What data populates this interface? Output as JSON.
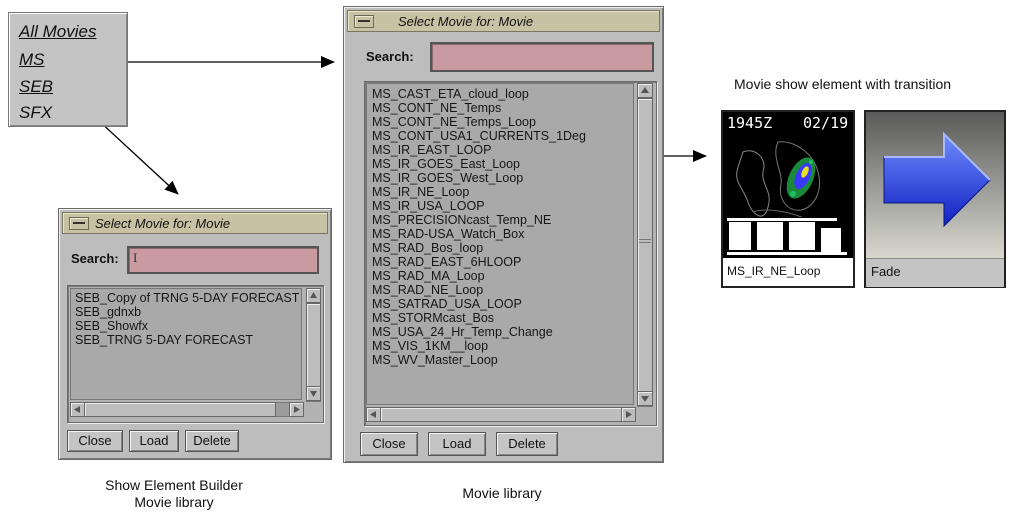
{
  "menu": {
    "items": [
      "All Movies",
      "MS",
      "SEB",
      "SFX"
    ]
  },
  "small_window": {
    "title": "Select Movie for: Movie",
    "search_label": "Search:",
    "search_value": "I",
    "list": [
      "SEB_Copy of TRNG 5-DAY FORECAST",
      "SEB_gdnxb",
      "SEB_Showfx",
      "SEB_TRNG 5-DAY FORECAST"
    ],
    "buttons": {
      "close": "Close",
      "load": "Load",
      "delete": "Delete"
    }
  },
  "large_window": {
    "title": "Select Movie for: Movie",
    "search_label": "Search:",
    "search_value": "",
    "list": [
      "MS_CAST_ETA_cloud_loop",
      "MS_CONT_NE_Temps",
      "MS_CONT_NE_Temps_Loop",
      "MS_CONT_USA1_CURRENTS_1Deg",
      "MS_IR_EAST_LOOP",
      "MS_IR_GOES_East_Loop",
      "MS_IR_GOES_West_Loop",
      "MS_IR_NE_Loop",
      "MS_IR_USA_LOOP",
      "MS_PRECISIONcast_Temp_NE",
      "MS_RAD-USA_Watch_Box",
      "MS_RAD_Bos_loop",
      "MS_RAD_EAST_6HLOOP",
      "MS_RAD_MA_Loop",
      "MS_RAD_NE_Loop",
      "MS_SATRAD_USA_LOOP",
      "MS_STORMcast_Bos",
      "MS_USA_24_Hr_Temp_Change",
      "MS_VIS_1KM__loop",
      "MS_WV_Master_Loop"
    ],
    "buttons": {
      "close": "Close",
      "load": "Load",
      "delete": "Delete"
    }
  },
  "show_element": {
    "heading": "Movie show element with transition",
    "movie_time": "1945Z",
    "movie_date": "02/19",
    "movie_label": "MS_IR_NE_Loop",
    "transition_label": "Fade"
  },
  "captions": {
    "seb_library_line1": "Show Element Builder",
    "seb_library_line2": "Movie library",
    "movie_library": "Movie library"
  },
  "colors": {
    "search_field": "#c99a9f",
    "arrow_blue": "#1f3fe0",
    "titlebar": "#c8c2a4"
  }
}
